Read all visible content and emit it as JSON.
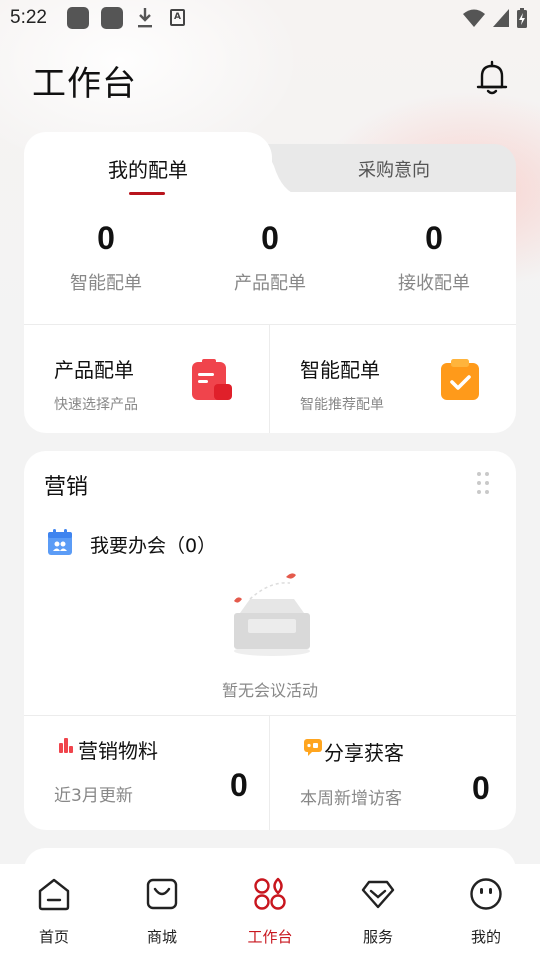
{
  "status_bar": {
    "time": "5:22",
    "icons": [
      "app-icon",
      "app-icon",
      "download-icon",
      "font-icon",
      "wifi-icon",
      "signal-icon",
      "battery-charging-icon"
    ]
  },
  "header": {
    "title": "工作台",
    "bell_icon": "bell-icon"
  },
  "orders": {
    "tabs": [
      {
        "label": "我的配单",
        "active": true
      },
      {
        "label": "采购意向",
        "active": false
      }
    ],
    "stats": [
      {
        "value": "0",
        "label": "智能配单"
      },
      {
        "value": "0",
        "label": "产品配单"
      },
      {
        "value": "0",
        "label": "接收配单"
      }
    ],
    "actions": [
      {
        "title": "产品配单",
        "subtitle": "快速选择产品",
        "icon": "product-order-icon",
        "color": "#f0444c"
      },
      {
        "title": "智能配单",
        "subtitle": "智能推荐配单",
        "icon": "clipboard-check-icon",
        "color": "#ff9a1a"
      }
    ]
  },
  "marketing": {
    "title": "营销",
    "more_icon": "drag-handle-icon",
    "meeting": {
      "label": "我要办会（0）",
      "icon": "calendar-people-icon"
    },
    "empty_text": "暂无会议活动",
    "bottom": [
      {
        "title": "营销物料",
        "subtitle": "近3月更新",
        "value": "0",
        "icon": "bar-chart-icon"
      },
      {
        "title": "分享获客",
        "subtitle": "本周新增访客",
        "value": "0",
        "icon": "chat-share-icon"
      }
    ]
  },
  "bottom_nav": {
    "items": [
      {
        "label": "首页",
        "icon": "home-icon",
        "active": false
      },
      {
        "label": "商城",
        "icon": "shopping-bag-icon",
        "active": false
      },
      {
        "label": "工作台",
        "icon": "workbench-icon",
        "active": true
      },
      {
        "label": "服务",
        "icon": "diamond-icon",
        "active": false
      },
      {
        "label": "我的",
        "icon": "face-icon",
        "active": false
      }
    ],
    "active_color": "#c8161e"
  }
}
